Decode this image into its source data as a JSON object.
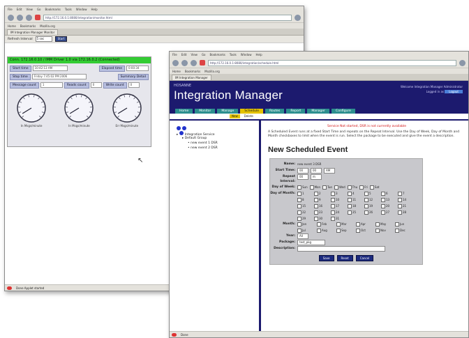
{
  "back_window": {
    "menu": [
      "File",
      "Edit",
      "View",
      "Go",
      "Bookmarks",
      "Tools",
      "Window",
      "Help"
    ],
    "url": "http://172.16.0.1:8080/integration/monitor.html",
    "bookmarks": [
      "Home",
      "Bookmarks",
      "Mozilla.org"
    ],
    "tab_title": "IM Integration Manager Monitor",
    "toolbar": {
      "refresh_label": "Refresh Interval",
      "refresh_value": "5 sec",
      "button_label": "Start"
    },
    "monitor": {
      "header_left": "Conn. 172.16.0.10 / IMM Driver 1.0 via 172.16.0.2 (Connected)",
      "header_right": "",
      "start_time_label": "Start time",
      "start_time_value": "10:42:13 AM",
      "elapsed_label": "Elapsed time",
      "elapsed_value": "0:00:34",
      "stop_time_label": "Stop time",
      "stop_time_value": "Friday 7:45:02 PM 2006",
      "summary_label": "Summary Detail",
      "messages_label": "Message count",
      "messages_value": "1",
      "reads_label": "Reads count",
      "reads_value": "0",
      "writes_label": "Write count",
      "writes_value": "0",
      "gauges": [
        {
          "caption": "In Msgs/minute",
          "level": 0.05
        },
        {
          "caption": "In Msgs/minute",
          "level": 0.05
        },
        {
          "caption": "Err Msgs/minute",
          "level": 0.05
        }
      ]
    },
    "status": "Done  Applet started"
  },
  "front_window": {
    "menu": [
      "File",
      "Edit",
      "View",
      "Go",
      "Bookmarks",
      "Tools",
      "Window",
      "Help"
    ],
    "url": "http://172.16.0.1:8080/integration/schedule.html",
    "bookmarks": [
      "Home",
      "Bookmarks",
      "Mozilla.org"
    ],
    "tab_title": "IM Integration Manager",
    "banner": {
      "brand_small": "HOSANNE",
      "brand_big": "Integration Manager",
      "right_line1": "Welcome Integration Manager Administrator",
      "right_line2": "Logged in as",
      "logout": "Logout"
    },
    "nav_tabs": [
      "Home",
      "Monitor",
      "Manage",
      "Schedule",
      "Routes",
      "Report",
      "Manager",
      "Configure"
    ],
    "active_tab": "Schedule",
    "sub_tabs": [
      "New",
      "Delete"
    ],
    "tree": {
      "root": "Integration Service",
      "group": "Default Group",
      "items": [
        "new event 1 DSR",
        "new event 2 DSR"
      ]
    },
    "warning": "Service Not started, DSR is not currently available",
    "help": "A Scheduled Event runs at a fixed Start Time and repeats on the Repeat Interval. Use the Day of Week, Day of Month and Month checkboxes to limit when the event is run. Select the package to be executed and give the event a description.",
    "heading": "New Scheduled Event",
    "form": {
      "name_label": "Name:",
      "name_value": "new event 3 DSR",
      "start_label": "Start Time:",
      "start_hour": "00",
      "start_min": "00",
      "start_ampm": "AM",
      "repeat_label": "Repeat Interval:",
      "repeat_value": "00",
      "repeat_unit": "m",
      "dow_label": "Day of Week:",
      "dow": [
        "Sun",
        "Mon",
        "Tue",
        "Wed",
        "Thu",
        "Fri",
        "Sat"
      ],
      "dom_label": "Day of Month:",
      "dom": [
        "1",
        "2",
        "3",
        "4",
        "5",
        "6",
        "7",
        "8",
        "9",
        "10",
        "11",
        "12",
        "13",
        "14",
        "15",
        "16",
        "17",
        "18",
        "19",
        "20",
        "21",
        "22",
        "23",
        "24",
        "25",
        "26",
        "27",
        "28",
        "29",
        "30",
        "31"
      ],
      "month_label": "Month:",
      "months": [
        "Jan",
        "Feb",
        "Mar",
        "Apr",
        "May",
        "Jun",
        "Jul",
        "Aug",
        "Sep",
        "Oct",
        "Nov",
        "Dec"
      ],
      "year_label": "Year:",
      "year_value": "All",
      "package_label": "Package:",
      "package_value": "test_pkg",
      "description_label": "Description:",
      "description_value": "",
      "buttons": [
        "Save",
        "Reset",
        "Cancel"
      ]
    },
    "status": "Done"
  }
}
